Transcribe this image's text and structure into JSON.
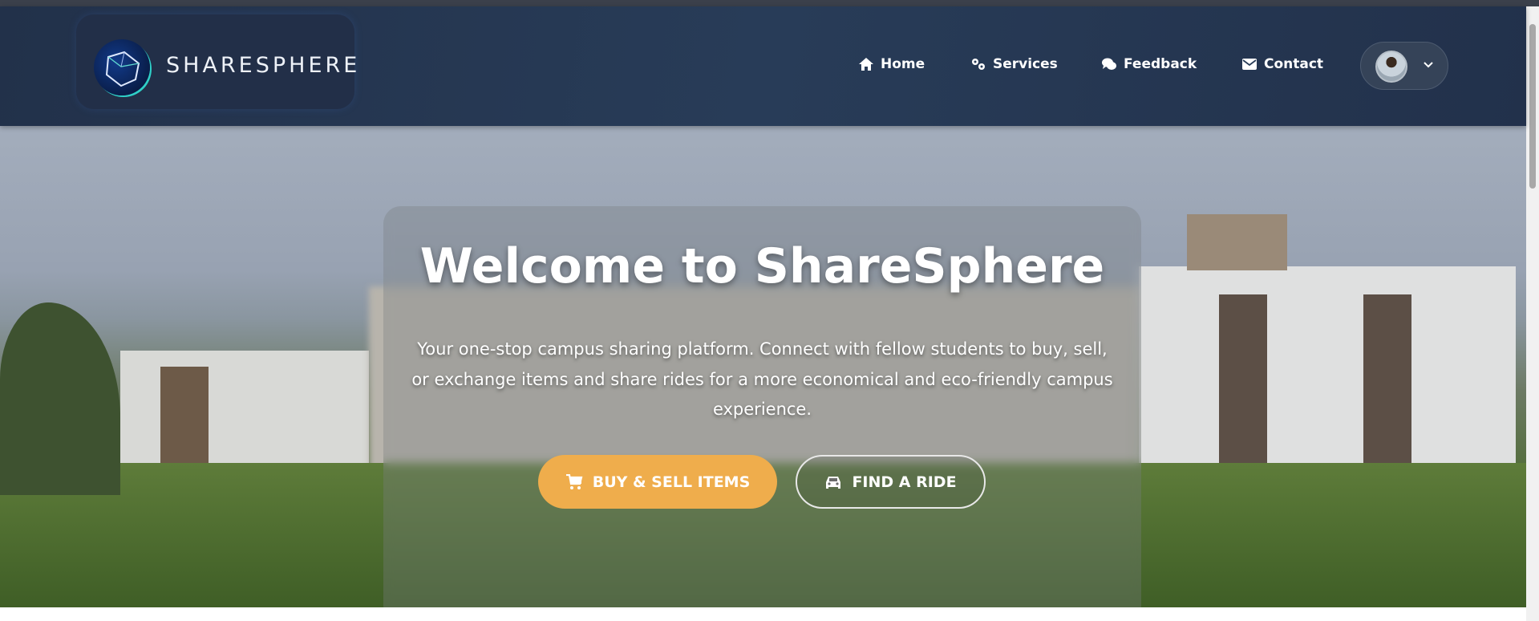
{
  "brand": {
    "name": "SHARESPHERE"
  },
  "nav": {
    "items": [
      {
        "label": "Home",
        "icon": "home-icon"
      },
      {
        "label": "Services",
        "icon": "cogs-icon"
      },
      {
        "label": "Feedback",
        "icon": "comments-icon"
      },
      {
        "label": "Contact",
        "icon": "envelope-icon"
      }
    ]
  },
  "hero": {
    "title": "Welcome to ShareSphere",
    "description": "Your one-stop campus sharing platform. Connect with fellow students to buy, sell, or exchange items and share rides for a more economical and eco-friendly campus experience.",
    "buy_label": "BUY & SELL ITEMS",
    "ride_label": "FIND A RIDE"
  },
  "colors": {
    "navbar": "#243550",
    "accent": "#efad4c"
  }
}
